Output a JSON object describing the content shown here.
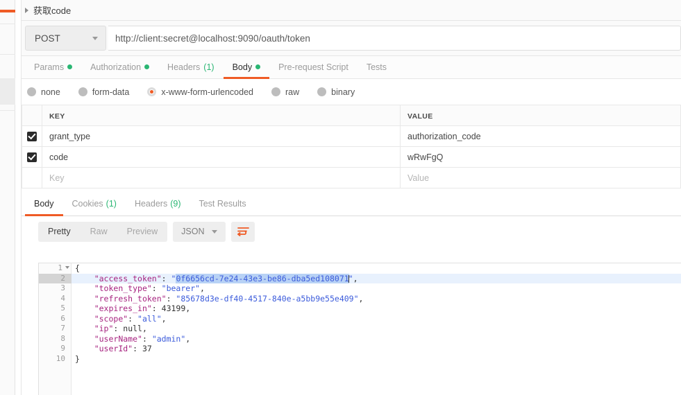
{
  "request": {
    "name": "获取code",
    "collapse_icon": "caret-right-icon",
    "method": "POST",
    "method_caret_icon": "chevron-down-icon",
    "url": "http://client:secret@localhost:9090/oauth/token",
    "tabs": [
      {
        "label": "Params",
        "indicator": "dot",
        "active": false
      },
      {
        "label": "Authorization",
        "indicator": "dot",
        "active": false
      },
      {
        "label": "Headers",
        "count": "(1)",
        "active": false
      },
      {
        "label": "Body",
        "indicator": "dot",
        "active": true
      },
      {
        "label": "Pre-request Script",
        "active": false
      },
      {
        "label": "Tests",
        "active": false
      }
    ],
    "body_types": [
      {
        "label": "none",
        "selected": false
      },
      {
        "label": "form-data",
        "selected": false
      },
      {
        "label": "x-www-form-urlencoded",
        "selected": true
      },
      {
        "label": "raw",
        "selected": false
      },
      {
        "label": "binary",
        "selected": false
      }
    ],
    "table": {
      "headers": {
        "key": "KEY",
        "value": "VALUE"
      },
      "rows": [
        {
          "checked": true,
          "key": "grant_type",
          "value": "authorization_code"
        },
        {
          "checked": true,
          "key": "code",
          "value": "wRwFgQ"
        }
      ],
      "placeholder_row": {
        "key": "Key",
        "value": "Value"
      }
    }
  },
  "response": {
    "tabs": [
      {
        "label": "Body",
        "active": true
      },
      {
        "label": "Cookies",
        "count": "(1)",
        "active": false
      },
      {
        "label": "Headers",
        "count": "(9)",
        "active": false
      },
      {
        "label": "Test Results",
        "active": false
      }
    ],
    "view_modes": [
      {
        "label": "Pretty",
        "active": true
      },
      {
        "label": "Raw",
        "active": false
      },
      {
        "label": "Preview",
        "active": false
      }
    ],
    "format": "JSON",
    "format_caret_icon": "chevron-down-icon",
    "wrap_button_icon": "word-wrap-icon",
    "body_lines": [
      {
        "num": "1",
        "foldable": true,
        "tokens": [
          {
            "t": "{",
            "c": "p"
          }
        ]
      },
      {
        "num": "2",
        "active": true,
        "tokens": [
          {
            "t": "    ",
            "c": "p"
          },
          {
            "t": "\"access_token\"",
            "c": "k"
          },
          {
            "t": ": ",
            "c": "p"
          },
          {
            "t": "\"",
            "c": "s"
          },
          {
            "t": "0f6656cd-7e24-43e3-be86-dba5ed108071",
            "c": "s",
            "sel": true
          },
          {
            "t": "caret",
            "c": "caret"
          },
          {
            "t": "\"",
            "c": "s"
          },
          {
            "t": ",",
            "c": "p"
          }
        ]
      },
      {
        "num": "3",
        "tokens": [
          {
            "t": "    ",
            "c": "p"
          },
          {
            "t": "\"token_type\"",
            "c": "k"
          },
          {
            "t": ": ",
            "c": "p"
          },
          {
            "t": "\"bearer\"",
            "c": "s"
          },
          {
            "t": ",",
            "c": "p"
          }
        ]
      },
      {
        "num": "4",
        "tokens": [
          {
            "t": "    ",
            "c": "p"
          },
          {
            "t": "\"refresh_token\"",
            "c": "k"
          },
          {
            "t": ": ",
            "c": "p"
          },
          {
            "t": "\"85678d3e-df40-4517-840e-a5bb9e55e409\"",
            "c": "s"
          },
          {
            "t": ",",
            "c": "p"
          }
        ]
      },
      {
        "num": "5",
        "tokens": [
          {
            "t": "    ",
            "c": "p"
          },
          {
            "t": "\"expires_in\"",
            "c": "k"
          },
          {
            "t": ": ",
            "c": "p"
          },
          {
            "t": "43199",
            "c": "n"
          },
          {
            "t": ",",
            "c": "p"
          }
        ]
      },
      {
        "num": "6",
        "tokens": [
          {
            "t": "    ",
            "c": "p"
          },
          {
            "t": "\"scope\"",
            "c": "k"
          },
          {
            "t": ": ",
            "c": "p"
          },
          {
            "t": "\"all\"",
            "c": "s"
          },
          {
            "t": ",",
            "c": "p"
          }
        ]
      },
      {
        "num": "7",
        "tokens": [
          {
            "t": "    ",
            "c": "p"
          },
          {
            "t": "\"ip\"",
            "c": "k"
          },
          {
            "t": ": ",
            "c": "p"
          },
          {
            "t": "null",
            "c": "n"
          },
          {
            "t": ",",
            "c": "p"
          }
        ]
      },
      {
        "num": "8",
        "tokens": [
          {
            "t": "    ",
            "c": "p"
          },
          {
            "t": "\"userName\"",
            "c": "k"
          },
          {
            "t": ": ",
            "c": "p"
          },
          {
            "t": "\"admin\"",
            "c": "s"
          },
          {
            "t": ",",
            "c": "p"
          }
        ]
      },
      {
        "num": "9",
        "tokens": [
          {
            "t": "    ",
            "c": "p"
          },
          {
            "t": "\"userId\"",
            "c": "k"
          },
          {
            "t": ": ",
            "c": "p"
          },
          {
            "t": "37",
            "c": "n"
          }
        ]
      },
      {
        "num": "10",
        "tokens": [
          {
            "t": "}",
            "c": "p"
          }
        ]
      }
    ]
  },
  "colors": {
    "accent": "#ef5b25",
    "green": "#2ab673",
    "selection": "#b8d2f5",
    "active_line": "#e8f1fd"
  }
}
